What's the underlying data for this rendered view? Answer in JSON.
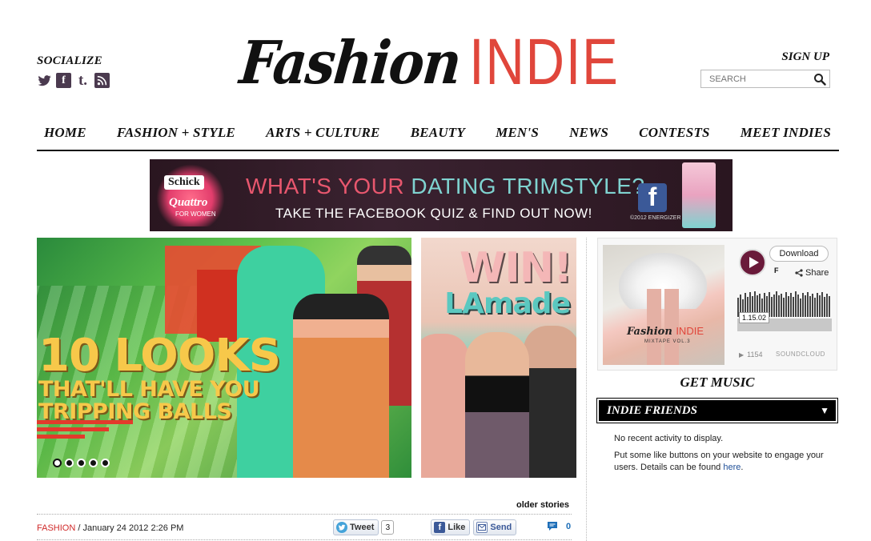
{
  "header": {
    "socialize": "SOCIALIZE",
    "social_icons": [
      "twitter-icon",
      "facebook-icon",
      "tumblr-icon",
      "rss-icon"
    ],
    "logo_script": "Fashion",
    "logo_word": "INDIE",
    "signup": "SIGN UP",
    "search_placeholder": "SEARCH"
  },
  "nav": [
    "HOME",
    "FASHION + STYLE",
    "ARTS + CULTURE",
    "BEAUTY",
    "MEN'S",
    "NEWS",
    "CONTESTS",
    "MEET INDIES"
  ],
  "banner": {
    "brand": "Schick",
    "brand_sub": "Quattro",
    "brand_sub2": "FOR WOMEN",
    "headline_a": "WHAT'S YOUR ",
    "headline_b": "DATING TRIMSTYLE?",
    "sub": "TAKE THE FACEBOOK QUIZ & FIND OUT NOW!",
    "fb": "f",
    "copyright": "©2012 ENERGIZER"
  },
  "feature": {
    "line1": "10 LOOKS",
    "line2": "THAT'LL HAVE YOU",
    "line3": "TRIPPING BALLS",
    "slides": 5,
    "active_slide": 1
  },
  "promo": {
    "line1": "WIN!",
    "line2": "LAmade"
  },
  "post": {
    "older": "older stories",
    "category": "FASHION",
    "date": " / January 24 2012 2:26 PM",
    "tweet": "Tweet",
    "tweet_count": "3",
    "like": "Like",
    "send": "Send",
    "comments": "0"
  },
  "music": {
    "album_title_a": "Fashion",
    "album_title_b": "INDIE",
    "album_sub": "MIXTAPE VOL.3",
    "download": "Download",
    "track_initial": "F",
    "share": "Share",
    "time": "1.15.02",
    "plays": "1154",
    "soundcloud": "SOUNDCLOUD",
    "get_music": "GET MUSIC"
  },
  "friends": {
    "title": "INDIE FRIENDS",
    "toggle": "▼",
    "empty": "No recent activity to display.",
    "note": "Put some like buttons on your website to engage your users. Details can be found ",
    "link": "here",
    "period": "."
  }
}
